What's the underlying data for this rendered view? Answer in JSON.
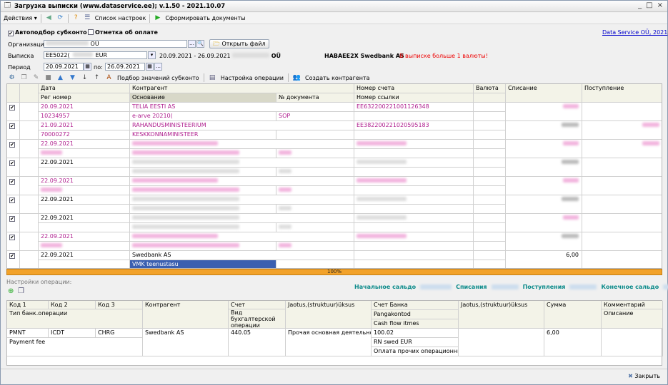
{
  "window": {
    "title": "Загрузка выписки (www.dataservice.ee); v.1.50 - 2021.10.07",
    "controls": [
      "_",
      "□",
      "×"
    ]
  },
  "toolbar": {
    "actions": "Действия",
    "settings_list": "Список настроек",
    "generate": "Сформировать документы"
  },
  "top": {
    "autopick": "Автоподбор субконто",
    "payment_mark": "Отметка об оплате",
    "link": "Data Service OÜ, 2021",
    "org_label": "Организация",
    "org_value": "OÜ",
    "open_file": "Открыть файл",
    "statement_label": "Выписка",
    "statement_value": "EE5022(",
    "currency": "EUR",
    "statement_period": "20.09.2021 - 26.09.2021",
    "statement_suffix": "OÜ",
    "bank": "HABAEE2X Swedbank AS",
    "warning": "В выписке больше 1 валюты!",
    "period_label": "Период",
    "period_from": "20.09.2021",
    "period_to_label": "по:",
    "period_to": "26.09.2021"
  },
  "toolbar2": {
    "pick": "Подбор значений субконто",
    "op_settings": "Настройка операции",
    "create_cp": "Создать контрагента"
  },
  "grid": {
    "headers": {
      "date": "Дата",
      "reg": "Рег номер",
      "counterparty": "Контрагент",
      "basis": "Основание",
      "docnum": "№ документа",
      "account": "Номер счета",
      "ref": "Номер ссылки",
      "currency": "Валюта",
      "debit": "Списание",
      "credit": "Поступление"
    },
    "rows": [
      {
        "date": "20.09.2021",
        "reg": "10234957",
        "cp": "TELIA EESTI AS",
        "basis": "e-arve 20210(",
        "doc": "SOP",
        "acc": "EE632200221001126348",
        "pink": true
      },
      {
        "date": "21.09.2021",
        "reg": "70000272",
        "cp": "RAHANDUSMINISTEERIUM",
        "basis": "KESKKONNAMINISTEER",
        "doc": "",
        "acc": "EE382200221020595183",
        "pink": true
      },
      {
        "date": "22.09.2021",
        "pink": true
      },
      {
        "date": "22.09.2021"
      },
      {
        "date": "22.09.2021",
        "pink": true
      },
      {
        "date": "22.09.2021"
      },
      {
        "date": "22.09.2021"
      },
      {
        "date": "22.09.2021",
        "pink": true
      },
      {
        "date": "22.09.2021",
        "cp": "Swedbank AS",
        "basis": "VMK teenustasu",
        "debit": "6,00"
      }
    ],
    "progress": "100%"
  },
  "balances": {
    "opening": "Начальное сальдо",
    "debits": "Списания",
    "credits": "Поступления",
    "closing": "Конечное сальдо"
  },
  "ops": {
    "title": "Настройки операции:",
    "headers": {
      "kod1": "Код 1",
      "kod2": "Код 2",
      "kod3": "Код 3",
      "cp": "Контрагент",
      "acc": "Счет",
      "jaotus": "Jaotus,(struktuur)üksus",
      "bankacc": "Счет Банка",
      "jaotus2": "Jaotus,(struktuur)üksus",
      "sum": "Сумма",
      "comment": "Комментарий",
      "optype": "Тип банк.операции",
      "optype2": "Вид бухгалтерской операции",
      "pangakontod": "Pangakontod",
      "cashflow": "Cash flow itmes",
      "desc": "Описание"
    },
    "row": {
      "kod1": "PMNT",
      "kod2": "ICDT",
      "kod3": "CHRG",
      "cp": "Swedbank AS",
      "acc": "440.05",
      "jaotus": "Прочая основная деятельность",
      "bankacc": "100.02",
      "sum": "6,00",
      "optype": "Payment fee",
      "rn": "RN swed EUR",
      "cf": "Оплата прочих операционных з..."
    }
  },
  "footer": {
    "close": "Закрыть"
  }
}
